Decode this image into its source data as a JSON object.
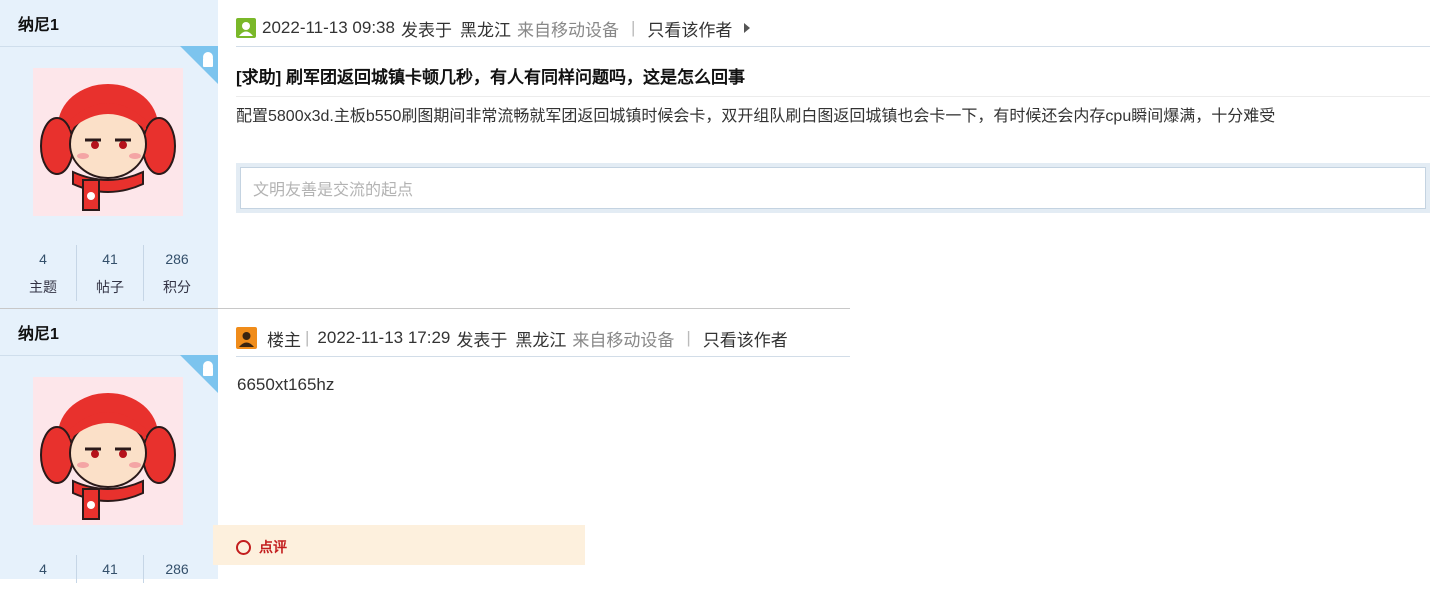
{
  "post1": {
    "author": "纳尼1",
    "stats": [
      {
        "value": "4",
        "label": "主题"
      },
      {
        "value": "41",
        "label": "帖子"
      },
      {
        "value": "286",
        "label": "积分"
      }
    ],
    "datetime": "2022-11-13 09:38",
    "posted_at_label": "发表于",
    "location": "黑龙江",
    "device": "来自移动设备",
    "separator": "|",
    "view_author_only": "只看该作者",
    "title": "[求助] 刷军团返回城镇卡顿几秒，有人有同样问题吗，这是怎么回事",
    "content": "配置5800x3d.主板b550刷图期间非常流畅就军团返回城镇时候会卡，双开组队刷白图返回城镇也会卡一下，有时候还会内存cpu瞬间爆满，十分难受",
    "reply_placeholder": "文明友善是交流的起点"
  },
  "post2": {
    "author": "纳尼1",
    "stats": [
      {
        "value": "4"
      },
      {
        "value": "41"
      },
      {
        "value": "286"
      }
    ],
    "role": "楼主",
    "separator": "|",
    "datetime": "2022-11-13 17:29",
    "posted_at_label": "发表于",
    "location": "黑龙江",
    "device": "来自移动设备",
    "view_author_only": "只看该作者",
    "content": "6650xt165hz",
    "comment_label": "点评"
  },
  "colors": {
    "sidebar_bg": "#e6f1fb",
    "avatar_bg": "#fde6ea",
    "comment_bg": "#fdf0dd",
    "comment_text": "#c31d1d",
    "corner_badge": "#7cc4ee"
  },
  "icons": {
    "post1_user": "green-user-icon",
    "post2_owner": "orange-owner-icon",
    "view_author_arrow": "triangle-right-icon",
    "corner_badge": "android-icon"
  }
}
